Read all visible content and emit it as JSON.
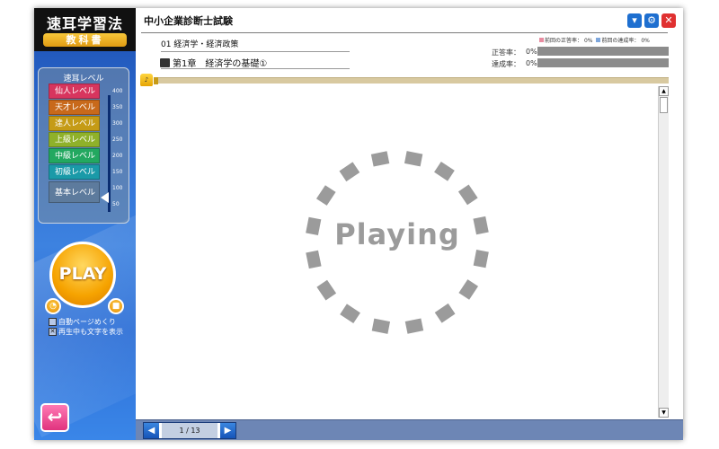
{
  "sidebar": {
    "logo_title": "速耳学習法",
    "logo_subtitle": "教科書",
    "level_panel_title": "速耳レベル",
    "levels": [
      {
        "label": "仙人レベル",
        "color": "#d7355e"
      },
      {
        "label": "天才レベル",
        "color": "#c8691b"
      },
      {
        "label": "達人レベル",
        "color": "#c59b16"
      },
      {
        "label": "上級レベル",
        "color": "#8fb12a"
      },
      {
        "label": "中級レベル",
        "color": "#23a860"
      },
      {
        "label": "初級レベル",
        "color": "#1a9aa8"
      },
      {
        "label": "基本レベル",
        "color": "#5d7b9d"
      }
    ],
    "scale_ticks": [
      "400",
      "350",
      "300",
      "250",
      "200",
      "150",
      "100",
      "50"
    ],
    "play_label": "PLAY",
    "checkboxes": [
      {
        "label": "自動ページめくり",
        "checked": false
      },
      {
        "label": "再生中も文字を表示",
        "checked": true
      }
    ],
    "back_icon": "return-arrow-icon"
  },
  "header": {
    "title": "中小企業診断士試験",
    "buttons": [
      {
        "name": "info-button",
        "glyph": "▼",
        "color": "#1e6fd0"
      },
      {
        "name": "settings-button",
        "glyph": "⚙",
        "color": "#1e6fd0"
      },
      {
        "name": "close-button",
        "glyph": "✕",
        "color": "#e03030"
      }
    ]
  },
  "lesson": {
    "subject": "01 経済学・経済政策",
    "chapter": "第1章　経済学の基礎①"
  },
  "stats": {
    "legend_prev_correct": "前回の正答率：",
    "legend_prev_correct_value": "0%",
    "legend_prev_achieve": "前回の達成率：",
    "legend_prev_achieve_value": "0%",
    "legend_prev_correct_color": "#e88ca0",
    "legend_prev_achieve_color": "#7ea7dd",
    "correct_label": "正答率：",
    "correct_value": "0%",
    "achieve_label": "達成率：",
    "achieve_value": "0%"
  },
  "player": {
    "status_text": "Playing",
    "progress": 0
  },
  "pager": {
    "text": "1 / 13"
  }
}
